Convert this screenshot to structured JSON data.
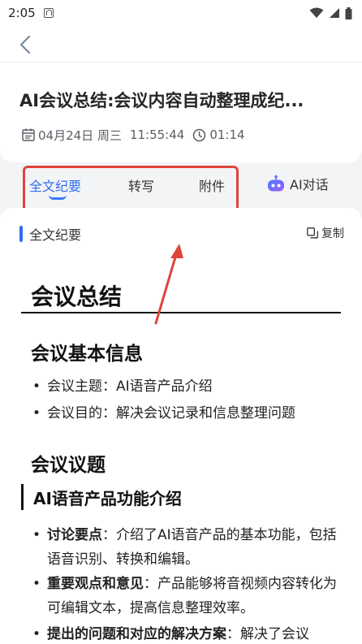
{
  "status": {
    "time": "2:05"
  },
  "header": {
    "title": "AI会议总结:会议内容自动整理成纪...",
    "date": "04月24日 周三",
    "time": "11:55:44",
    "duration": "01:14"
  },
  "tabs": [
    {
      "label": "全文纪要"
    },
    {
      "label": "转写"
    },
    {
      "label": "附件"
    }
  ],
  "ai_chat_label": "AI对话",
  "content": {
    "section_title": "全文纪要",
    "copy_label": "复制",
    "h1": "会议总结",
    "basic_info_title": "会议基本信息",
    "basic_info": [
      "会议主题：AI语音产品介绍",
      "会议目的：解决会议记录和信息整理问题"
    ],
    "topics_title": "会议议题",
    "topic_title": "AI语音产品功能介绍",
    "points": [
      {
        "label": "讨论要点",
        "text": "：介绍了AI语音产品的基本功能，包括语音识别、转换和编辑。"
      },
      {
        "label": "重要观点和意见",
        "text": "：产品能够将音视频内容转化为可编辑文本，提高信息整理效率。"
      },
      {
        "label": "提出的问题和对应的解决方案",
        "text": "：解决了会议"
      }
    ]
  },
  "colors": {
    "accent": "#2f6df6",
    "highlight": "#e0443a"
  }
}
